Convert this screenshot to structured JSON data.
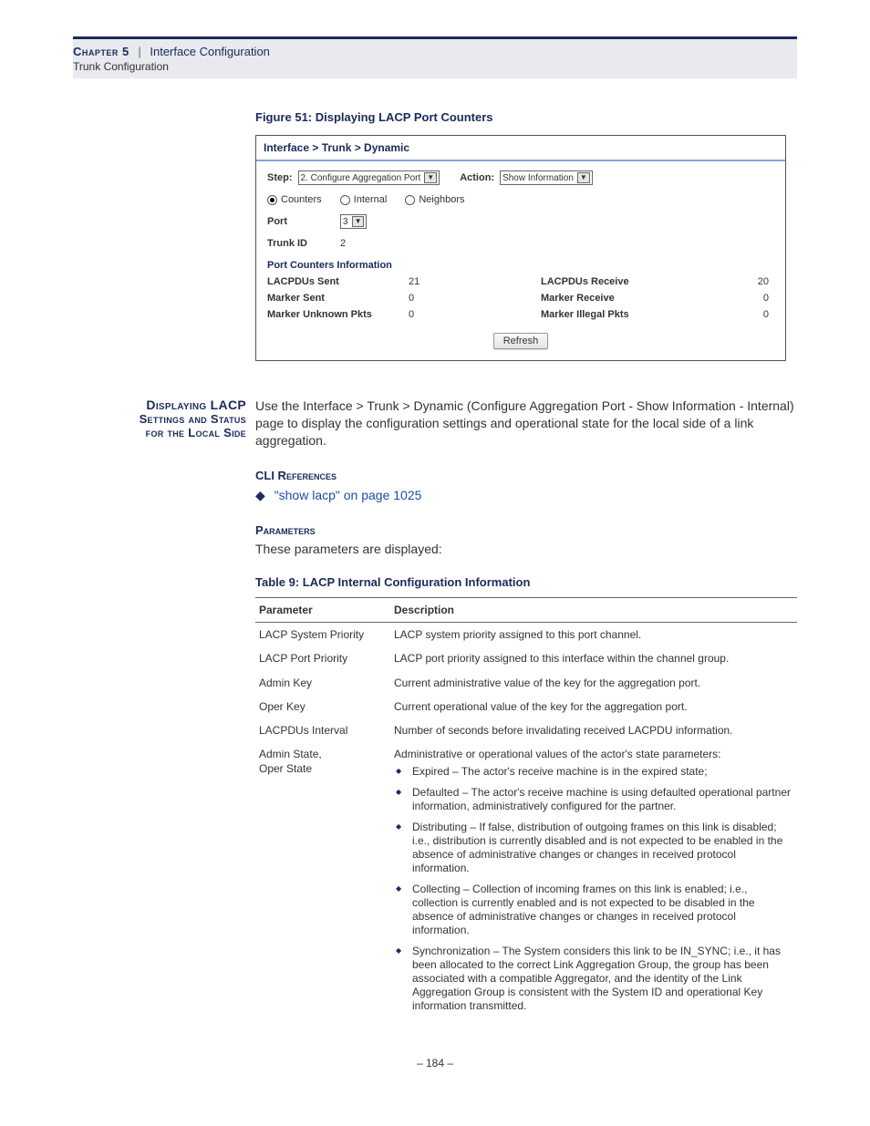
{
  "header": {
    "chapter": "Chapter 5",
    "sep": "|",
    "title": "Interface Configuration",
    "subtitle": "Trunk Configuration"
  },
  "figure": {
    "caption": "Figure 51:  Displaying LACP Port Counters"
  },
  "screenshot": {
    "breadcrumb": "Interface > Trunk > Dynamic",
    "step_label": "Step:",
    "step_value": "2. Configure Aggregation Port",
    "action_label": "Action:",
    "action_value": "Show Information",
    "radios": {
      "counters": "Counters",
      "internal": "Internal",
      "neighbors": "Neighbors",
      "selected": "counters"
    },
    "port_label": "Port",
    "port_value": "3",
    "trunk_label": "Trunk ID",
    "trunk_value": "2",
    "section": "Port Counters Information",
    "counters": [
      {
        "l": "LACPDUs Sent",
        "lv": "21",
        "r": "LACPDUs Receive",
        "rv": "20"
      },
      {
        "l": "Marker Sent",
        "lv": "0",
        "r": "Marker Receive",
        "rv": "0"
      },
      {
        "l": "Marker Unknown Pkts",
        "lv": "0",
        "r": "Marker Illegal Pkts",
        "rv": "0"
      }
    ],
    "refresh": "Refresh"
  },
  "body": {
    "side_heading_l1": "Displaying LACP",
    "side_heading_l2": "Settings and Status",
    "side_heading_l3": "for the Local Side",
    "intro": "Use the Interface > Trunk > Dynamic (Configure Aggregation Port - Show Information - Internal) page to display the configuration settings and operational state for the local side of a link aggregation.",
    "cli_heading": "CLI References",
    "cli_link": "\"show lacp\" on page 1025",
    "params_heading": "Parameters",
    "params_intro": "These parameters are displayed:",
    "table_caption": "Table 9: LACP Internal Configuration Information",
    "th_param": "Parameter",
    "th_desc": "Description",
    "rows": [
      {
        "p": "LACP System Priority",
        "d": "LACP system priority assigned to this port channel."
      },
      {
        "p": "LACP Port Priority",
        "d": "LACP port priority assigned to this interface within the channel group."
      },
      {
        "p": "Admin Key",
        "d": "Current administrative value of the key for the aggregation port."
      },
      {
        "p": "Oper Key",
        "d": "Current operational value of the key for the aggregation port."
      },
      {
        "p": "LACPDUs Interval",
        "d": "Number of seconds before invalidating received LACPDU information."
      }
    ],
    "state_row": {
      "p1": "Admin State,",
      "p2": "Oper State",
      "intro": "Administrative or operational values of the actor's state parameters:",
      "items": [
        "Expired – The actor's receive machine is in the expired state;",
        "Defaulted – The actor's receive machine is using defaulted operational partner information, administratively configured for the partner.",
        "Distributing – If false, distribution of outgoing frames on this link is disabled; i.e., distribution is currently disabled and is not expected to be enabled in the absence of administrative changes or changes in received protocol information.",
        "Collecting – Collection of incoming frames on this link is enabled; i.e., collection is currently enabled and is not expected to be disabled in the absence of administrative changes or changes in received protocol information.",
        "Synchronization – The System considers this link to be IN_SYNC; i.e., it has been allocated to the correct Link Aggregation Group, the group has been associated with a compatible Aggregator, and the identity of the Link Aggregation Group is consistent with the System ID and operational Key information transmitted."
      ]
    }
  },
  "page_number": "–  184  –"
}
